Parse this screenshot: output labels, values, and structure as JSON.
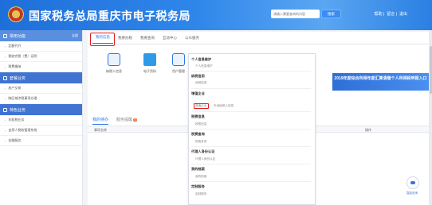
{
  "header": {
    "title": "国家税务总局重庆市电子税务局",
    "search_placeholder": "请输入需要查询的内容",
    "search_button": "搜索",
    "links": [
      "帮助",
      "留言",
      "退出"
    ]
  },
  "sidebar": {
    "groups": [
      {
        "label": "常用功能",
        "action": "全部",
        "items": [
          "定额代开",
          "税收完税（费）证明",
          "税费缴纳"
        ]
      },
      {
        "label": "套餐业务",
        "items": [
          "房产交易",
          "跨区域涉税事项办理"
        ]
      },
      {
        "label": "特色业务",
        "items": [
          "车船税业务",
          "自然人税收管理系统",
          "金融服务"
        ]
      }
    ]
  },
  "main": {
    "tabs": [
      "我的信息",
      "我要办税",
      "我要查询",
      "互动中心",
      "公众服务"
    ],
    "tiles": [
      "纳税人信息",
      "电子资料",
      "用户管理"
    ],
    "banner": "2019年度综合所得年度汇算清缴个人所得税申报入口",
    "todo_tabs": [
      {
        "label": "我的待办"
      },
      {
        "label": "服务提醒",
        "badge": "0"
      }
    ],
    "table_headers": [
      "事项名称",
      "操作"
    ]
  },
  "dropdown": {
    "sections": [
      {
        "heading": "个人信息维护",
        "items": [
          "个人信息维护"
        ]
      },
      {
        "heading": "纳税信用",
        "items": [
          "纳税信用"
        ]
      },
      {
        "heading": "增值企业",
        "items": [
          "增值企业",
          "外地纳税人信息"
        ]
      },
      {
        "heading": "税费信息",
        "items": [
          "税费信息"
        ]
      },
      {
        "heading": "税费查询",
        "items": [
          "税费查询"
        ]
      },
      {
        "heading": "代理人身份认证",
        "items": [
          "代理人身份认证"
        ]
      },
      {
        "heading": "我的档案",
        "items": [
          "我的档案"
        ]
      },
      {
        "heading": "定制服务",
        "items": [
          "定制服务"
        ]
      }
    ]
  },
  "robot_label": "智能咨询"
}
